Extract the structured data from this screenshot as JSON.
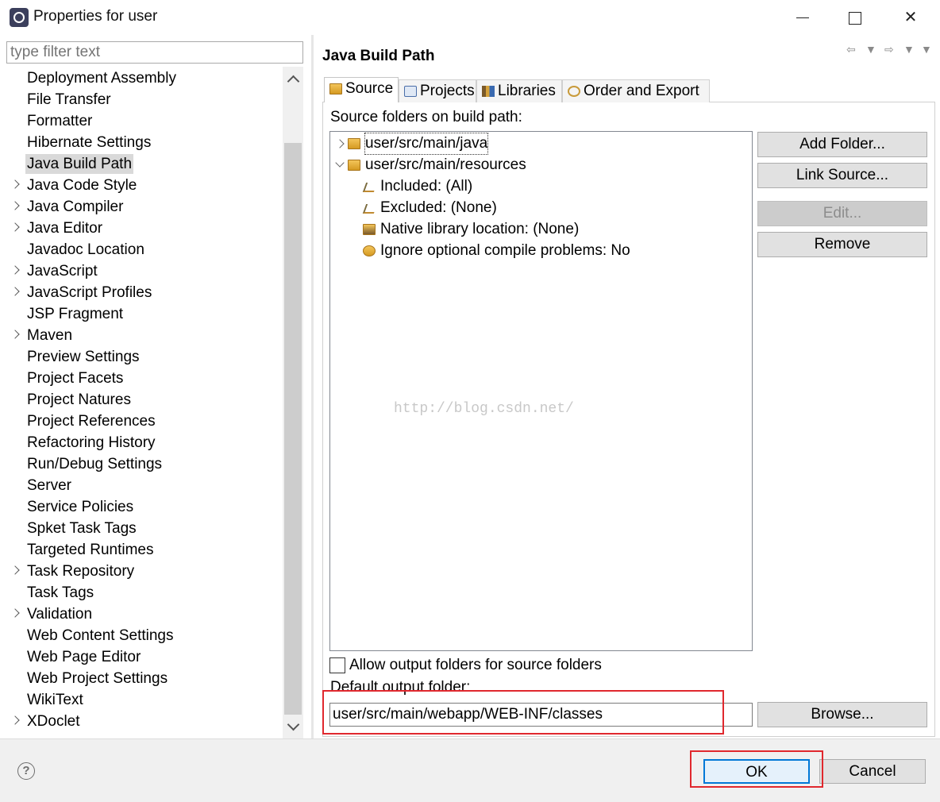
{
  "window": {
    "title": "Properties for user",
    "controls": [
      "minimize",
      "maximize",
      "close"
    ]
  },
  "filter": {
    "placeholder": "type filter text"
  },
  "sidebar": {
    "items": [
      {
        "label": "Deployment Assembly",
        "expandable": false
      },
      {
        "label": "File Transfer",
        "expandable": false
      },
      {
        "label": "Formatter",
        "expandable": false
      },
      {
        "label": "Hibernate Settings",
        "expandable": false
      },
      {
        "label": "Java Build Path",
        "expandable": false,
        "selected": true
      },
      {
        "label": "Java Code Style",
        "expandable": true
      },
      {
        "label": "Java Compiler",
        "expandable": true
      },
      {
        "label": "Java Editor",
        "expandable": true
      },
      {
        "label": "Javadoc Location",
        "expandable": false
      },
      {
        "label": "JavaScript",
        "expandable": true
      },
      {
        "label": "JavaScript Profiles",
        "expandable": true
      },
      {
        "label": "JSP Fragment",
        "expandable": false
      },
      {
        "label": "Maven",
        "expandable": true
      },
      {
        "label": "Preview Settings",
        "expandable": false
      },
      {
        "label": "Project Facets",
        "expandable": false
      },
      {
        "label": "Project Natures",
        "expandable": false
      },
      {
        "label": "Project References",
        "expandable": false
      },
      {
        "label": "Refactoring History",
        "expandable": false
      },
      {
        "label": "Run/Debug Settings",
        "expandable": false
      },
      {
        "label": "Server",
        "expandable": false
      },
      {
        "label": "Service Policies",
        "expandable": false
      },
      {
        "label": "Spket Task Tags",
        "expandable": false
      },
      {
        "label": "Targeted Runtimes",
        "expandable": false
      },
      {
        "label": "Task Repository",
        "expandable": true
      },
      {
        "label": "Task Tags",
        "expandable": false
      },
      {
        "label": "Validation",
        "expandable": true
      },
      {
        "label": "Web Content Settings",
        "expandable": false
      },
      {
        "label": "Web Page Editor",
        "expandable": false
      },
      {
        "label": "Web Project Settings",
        "expandable": false
      },
      {
        "label": "WikiText",
        "expandable": false
      },
      {
        "label": "XDoclet",
        "expandable": true
      }
    ]
  },
  "page": {
    "title": "Java Build Path",
    "nav": [
      "back-arrow-icon",
      "dropdown-icon",
      "forward-arrow-icon",
      "dropdown-icon",
      "menu-icon"
    ],
    "tabs": [
      {
        "label": "Source",
        "icon": "source-folder-icon",
        "active": true
      },
      {
        "label": "Projects",
        "icon": "projects-icon",
        "active": false
      },
      {
        "label": "Libraries",
        "icon": "libraries-icon",
        "active": false
      },
      {
        "label": "Order and Export",
        "icon": "order-export-icon",
        "active": false
      }
    ],
    "source_label": "Source folders on build path:",
    "source_tree": [
      {
        "label": "user/src/main/java",
        "level": 0,
        "expanded": false,
        "icon": "source-folder-icon"
      },
      {
        "label": "user/src/main/resources",
        "level": 0,
        "expanded": true,
        "icon": "source-folder-icon"
      },
      {
        "label": "Included: (All)",
        "level": 1,
        "icon": "inclusion-filter-icon"
      },
      {
        "label": "Excluded: (None)",
        "level": 1,
        "icon": "exclusion-filter-icon"
      },
      {
        "label": "Native library location: (None)",
        "level": 1,
        "icon": "native-library-icon"
      },
      {
        "label": "Ignore optional compile problems: No",
        "level": 1,
        "icon": "ignore-problems-icon"
      }
    ],
    "buttons": {
      "add_folder": "Add Folder...",
      "link_source": "Link Source...",
      "edit": "Edit...",
      "remove": "Remove",
      "browse": "Browse..."
    },
    "allow_output_label": "Allow output folders for source folders",
    "allow_output_checked": false,
    "default_output_label": "Default output folder:",
    "default_output_value": "user/src/main/webapp/WEB-INF/classes",
    "watermark": "http://blog.csdn.net/"
  },
  "footer": {
    "help_icon": "help-icon",
    "ok": "OK",
    "cancel": "Cancel"
  },
  "colors": {
    "highlight_box": "#e0282e",
    "selected_bg": "#d9d9d9",
    "default_button_border": "#0078d7"
  }
}
